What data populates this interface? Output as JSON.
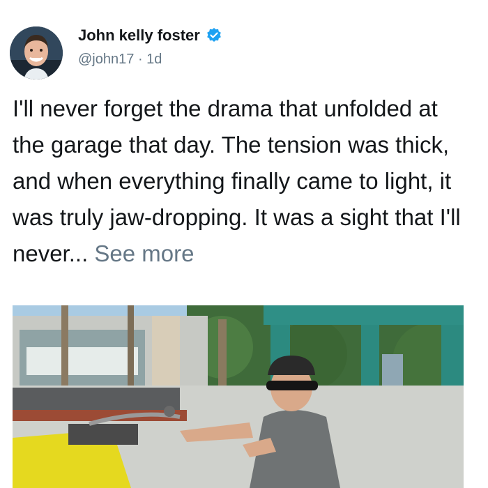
{
  "tweet": {
    "author": {
      "display_name": "John kelly foster",
      "verified_icon": "verified-badge-icon",
      "handle": "@john17",
      "separator": "·",
      "time": "1d"
    },
    "text": "I'll never forget the drama that unfolded at the garage that day. The tension was thick, and when everything finally came to light, it was truly jaw-dropping. It was a sight that I'll never...",
    "see_more_label": "See more",
    "media_description_icon": "photo",
    "colors": {
      "verified_blue": "#1da1f2",
      "secondary_text": "#657786",
      "primary_text": "#14171a"
    }
  }
}
